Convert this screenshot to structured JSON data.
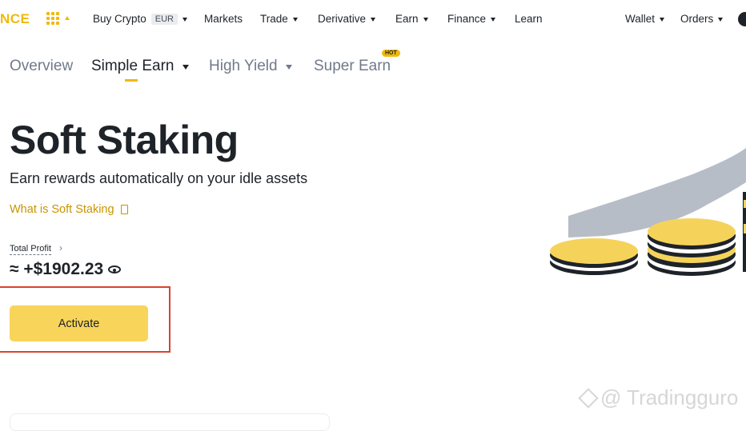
{
  "header": {
    "logo_text": "NCE",
    "nav": {
      "buy_crypto": "Buy Crypto",
      "currency": "EUR",
      "markets": "Markets",
      "trade": "Trade",
      "derivative": "Derivative",
      "earn": "Earn",
      "finance": "Finance",
      "learn": "Learn",
      "wallet": "Wallet",
      "orders": "Orders"
    }
  },
  "tabs": {
    "overview": "Overview",
    "simple_earn": "Simple Earn",
    "high_yield": "High Yield",
    "super_earn": "Super Earn",
    "hot_badge": "HOT",
    "active": "Simple Earn"
  },
  "hero": {
    "title": "Soft Staking",
    "subtitle": "Earn rewards automatically on your idle assets",
    "link": "What is Soft Staking",
    "profit_label": "Total Profit",
    "profit_value": "≈ +$1902.23",
    "activate_label": "Activate"
  },
  "watermark": "@ Tradingguro",
  "colors": {
    "brand": "#f0b90b",
    "button": "#f8d45a",
    "link": "#c99400",
    "highlight": "#d9442e"
  },
  "icons": [
    "apps-grid-icon",
    "caret-icon",
    "book-icon",
    "chevron-right-icon",
    "eye-icon",
    "user-icon",
    "coins-illustration"
  ]
}
